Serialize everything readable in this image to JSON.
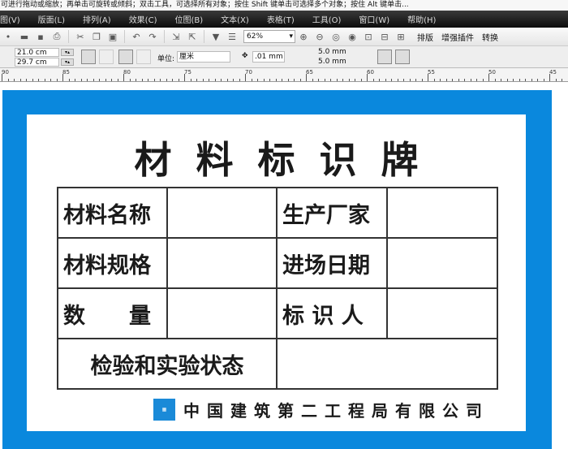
{
  "status_text": "可进行拖动或缩放；再单击可旋转或倾斜；双击工具，可选择所有对象；按住 Shift 键单击可选择多个对象；按住 Alt 键单击...",
  "menu": [
    "图(V)",
    "版面(L)",
    "排列(A)",
    "效果(C)",
    "位图(B)",
    "文本(X)",
    "表格(T)",
    "工具(O)",
    "窗口(W)",
    "帮助(H)"
  ],
  "toolbar": {
    "zoom": "62%",
    "buttons": [
      "排版",
      "增强插件",
      "转换"
    ]
  },
  "propbar": {
    "width": "21.0 cm",
    "height": "29.7 cm",
    "unit_label": "单位:",
    "unit": "厘米",
    "nudge": ".01 mm",
    "dup_x": "5.0 mm",
    "dup_y": "5.0 mm"
  },
  "ruler": [
    "90",
    "85",
    "80",
    "75",
    "70",
    "65",
    "60",
    "55",
    "50",
    "45"
  ],
  "sign": {
    "title": "材料标识牌",
    "rows": [
      [
        "材料名称",
        "",
        "生产厂家",
        ""
      ],
      [
        "材料规格",
        "",
        "进场日期",
        ""
      ],
      [
        "数　　量",
        "",
        "标 识 人",
        ""
      ]
    ],
    "last_row": "检验和实验状态",
    "company": "中国建筑第二工程局有限公司",
    "logo_text": "CSCEC"
  },
  "colors": {
    "frame": "#0a88dd"
  }
}
